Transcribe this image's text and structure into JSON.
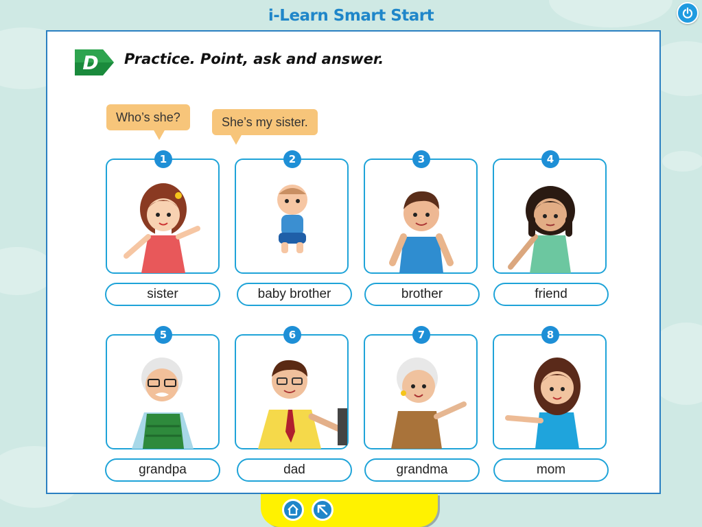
{
  "app": {
    "title": "i-Learn Smart Start"
  },
  "exercise": {
    "letter": "D",
    "instruction": "Practice. Point, ask and answer."
  },
  "speech": {
    "question": "Who’s she?",
    "answer": "She’s my sister."
  },
  "cards": [
    {
      "number": "1",
      "label": "sister"
    },
    {
      "number": "2",
      "label": "baby brother"
    },
    {
      "number": "3",
      "label": "brother"
    },
    {
      "number": "4",
      "label": "friend"
    },
    {
      "number": "5",
      "label": "grandpa"
    },
    {
      "number": "6",
      "label": "dad"
    },
    {
      "number": "7",
      "label": "grandma"
    },
    {
      "number": "8",
      "label": "mom"
    }
  ],
  "icons": {
    "power": "power-icon",
    "home": "home-icon",
    "back": "back-arrow-icon"
  },
  "colors": {
    "background": "#cfe9e4",
    "accent": "#1f86c9",
    "card_border": "#1ea3d8",
    "badge": "#1a8a3c",
    "bubble": "#f7c57a",
    "bottom_bar": "#fff200"
  }
}
